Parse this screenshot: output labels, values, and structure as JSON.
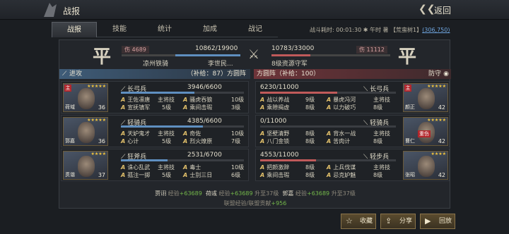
{
  "header": {
    "title": "战报",
    "back_label": "返回"
  },
  "tabs": [
    "战报",
    "技能",
    "统计",
    "加成",
    "战记"
  ],
  "battle_info": {
    "time_text": "战斗耗时: 00:01:30 ✱ 午时 暑",
    "land_text": "【荒蛮树1】",
    "coord_text": "(306,750)"
  },
  "summary": {
    "left": {
      "flag": "平",
      "loss": "伤 4689",
      "troops": "10862/19900",
      "name_a": "凉州铁骑",
      "name_b": "李世民...",
      "hp_frac": 0.546
    },
    "right": {
      "flag": "平",
      "loss": "伤 11112",
      "troops": "10783/33000",
      "name": "8级资源守军",
      "hp_frac": 0.327
    }
  },
  "attack_header": {
    "label": "进攻",
    "supply": "（补给：87）方圆阵"
  },
  "defense_header": {
    "label": "方圆阵（补给：100）",
    "role": "防守"
  },
  "attackers": [
    {
      "name": "荷域",
      "level": "36",
      "tag": "主",
      "stars": "★★★★★",
      "troop_type": "长弓兵",
      "troops": "3946/6600",
      "hp_frac": 0.598,
      "skills": [
        {
          "a": "王佐凛唐",
          "b": "主将技",
          "c": "10级"
        },
        {
          "a": "宣抚镇军",
          "b": "5级",
          "c": "A 乘间击瑕 3级"
        }
      ]
    },
    {
      "name": "郭嘉",
      "level": "36",
      "tag": "",
      "stars": "★★★★★",
      "troop_type": "轻骑兵",
      "troops": "4385/6600",
      "hp_frac": 0.664,
      "skills": [
        {
          "a": "天妒鬼才",
          "b": "主将技",
          "c": "5级"
        },
        {
          "a": "心计",
          "b": "5级",
          "c": "A 烈火燎原 7级"
        }
      ]
    },
    {
      "name": "贯谐",
      "level": "37",
      "tag": "",
      "stars": "★★★★",
      "troop_type": "狂斧兵",
      "troops": "2531/6700",
      "hp_frac": 0.378,
      "skills": [
        {
          "a": "诛心乱武",
          "b": "主将技",
          "c": "5级"
        },
        {
          "a": "孤注一掷",
          "b": "5级",
          "c": "A 士别三日 6级"
        }
      ]
    }
  ],
  "attacker_skill2": [
    [
      "骚虎吞狼",
      "10级"
    ],
    [
      "乘间击瑕",
      "3级"
    ],
    [
      "奇佐",
      "10级"
    ],
    [
      "烈火燎原",
      "7级"
    ],
    [
      "毒士",
      "10级"
    ],
    [
      "士别三日",
      "6级"
    ]
  ],
  "defenders": [
    {
      "name": "颜正",
      "level": "42",
      "tag": "主",
      "stars": "★★★★★",
      "troop_type": "长弓兵",
      "troops": "6230/11000",
      "hp_frac": 0.566,
      "skills": [
        [
          "战以养战",
          "9级"
        ],
        [
          "暴虎冯河",
          "主将技"
        ],
        [
          "乘隙揭虚",
          "8级"
        ],
        [
          "以力破巧",
          "8级"
        ]
      ]
    },
    {
      "name": "曹仁",
      "level": "42",
      "tag": "重伤",
      "stars": "★★★★★",
      "troop_type": "轻骑兵",
      "troops": "0/11000",
      "hp_frac": 0.0,
      "skills": [
        [
          "坚壁清野",
          "8级"
        ],
        [
          "背水一战",
          "主将技"
        ],
        [
          "八门金锁",
          "8级"
        ],
        [
          "苦肉计",
          "8级"
        ]
      ]
    },
    {
      "name": "张昭",
      "level": "42",
      "tag": "",
      "stars": "★★★★",
      "troop_type": "轻步兵",
      "troops": "4553/11000",
      "hp_frac": 0.414,
      "skills": [
        [
          "把颜激辞",
          "8级"
        ],
        [
          "上兵伐谋",
          "主将技"
        ],
        [
          "乘间击瑕",
          "8级"
        ],
        [
          "忌克妒魅",
          "8级"
        ]
      ]
    }
  ],
  "footer": {
    "line1": [
      {
        "n": "贾诩",
        "t": "经验",
        "v": "+63689"
      },
      {
        "n": "荷彧",
        "t": "经验",
        "v": "+63689",
        "e": "升至37级"
      },
      {
        "n": "郭嘉",
        "t": "经验",
        "v": "+63689",
        "e": "升至37级"
      }
    ],
    "line2_label": "联盟经验/联盟贡献",
    "line2_value": "+956"
  },
  "buttons": [
    {
      "icon": "☆",
      "label": "收藏"
    },
    {
      "icon": "⇪",
      "label": "分享"
    },
    {
      "icon": "▶",
      "label": "回放"
    }
  ],
  "colors": {
    "atk_bar": "#5f8fc0",
    "def_bar": "#c05a5a",
    "accent": "#e3c16b"
  }
}
